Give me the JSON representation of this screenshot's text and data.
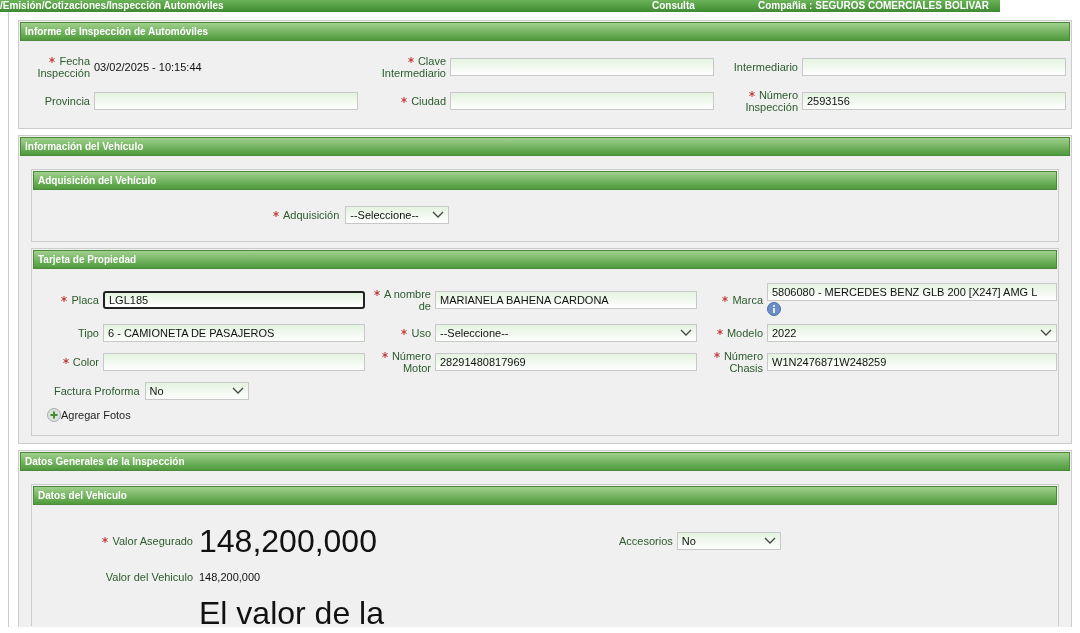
{
  "top_bar": {
    "path": "/Emisión/Cotizaciones/Inspección Automóviles",
    "mode": "Consulta",
    "company": "Compañia : SEGUROS COMERCIALES BOLIVAR"
  },
  "inspection_report": {
    "title": "Informe de Inspección de Automóviles",
    "fields": [
      {
        "label": "Fecha Inspección",
        "required": true,
        "kind": "static",
        "value": "03/02/2025 - 10:15:44"
      },
      {
        "label": "Clave Intermediario",
        "required": true,
        "kind": "input"
      },
      {
        "label": "Intermediario",
        "required": false,
        "kind": "input"
      },
      {
        "label": "Provincia",
        "required": false,
        "kind": "input"
      },
      {
        "label": "Ciudad",
        "required": true,
        "kind": "input"
      },
      {
        "label": "Número Inspección",
        "required": true,
        "kind": "input",
        "value": "2593156"
      }
    ]
  },
  "vehicle_info": {
    "title": "Información del Vehículo",
    "acquisition": {
      "title": "Adquisición del Vehículo",
      "field": {
        "label": "Adquisición",
        "required": true,
        "value": "--Seleccione--"
      }
    },
    "property_card": {
      "title": "Tarjeta de Propiedad",
      "fields": [
        {
          "label": "Placa",
          "required": true,
          "kind": "input",
          "value": "LGL185",
          "focused": true
        },
        {
          "label": "A nombre de",
          "required": true,
          "kind": "input",
          "value": "MARIANELA BAHENA CARDONA"
        },
        {
          "label": "Marca",
          "required": true,
          "kind": "input",
          "value": "5806080 - MERCEDES BENZ GLB 200 [X247] AMG L",
          "info": true
        },
        {
          "label": "Tipo",
          "required": false,
          "kind": "input",
          "value": "6 - CAMIONETA DE PASAJEROS"
        },
        {
          "label": "Uso",
          "required": true,
          "kind": "select",
          "value": "--Seleccione--"
        },
        {
          "label": "Modelo",
          "required": true,
          "kind": "select",
          "value": "2022"
        },
        {
          "label": "Color",
          "required": true,
          "kind": "input"
        },
        {
          "label": "Número Motor",
          "required": true,
          "kind": "input",
          "value": "28291480817969"
        },
        {
          "label": "Número Chasis",
          "required": true,
          "kind": "input",
          "value": "W1N2476871W248259"
        }
      ],
      "invoice": {
        "label": "Factura Proforma",
        "required": false,
        "value": "No"
      },
      "add_photos": "Agregar Fotos"
    }
  },
  "general_data": {
    "title": "Datos Generales de la Inspección",
    "vehicle_data": {
      "title": "Datos del Vehículo",
      "insured_value": {
        "label": "Valor Asegurado",
        "required": true,
        "value": "148,200,000"
      },
      "accessories": {
        "label": "Accesorios",
        "required": false,
        "value": "No"
      },
      "vehicle_value": {
        "label": "Valor del Vehiculo",
        "value": "148,200,000"
      },
      "note": "El valor de la"
    }
  }
}
